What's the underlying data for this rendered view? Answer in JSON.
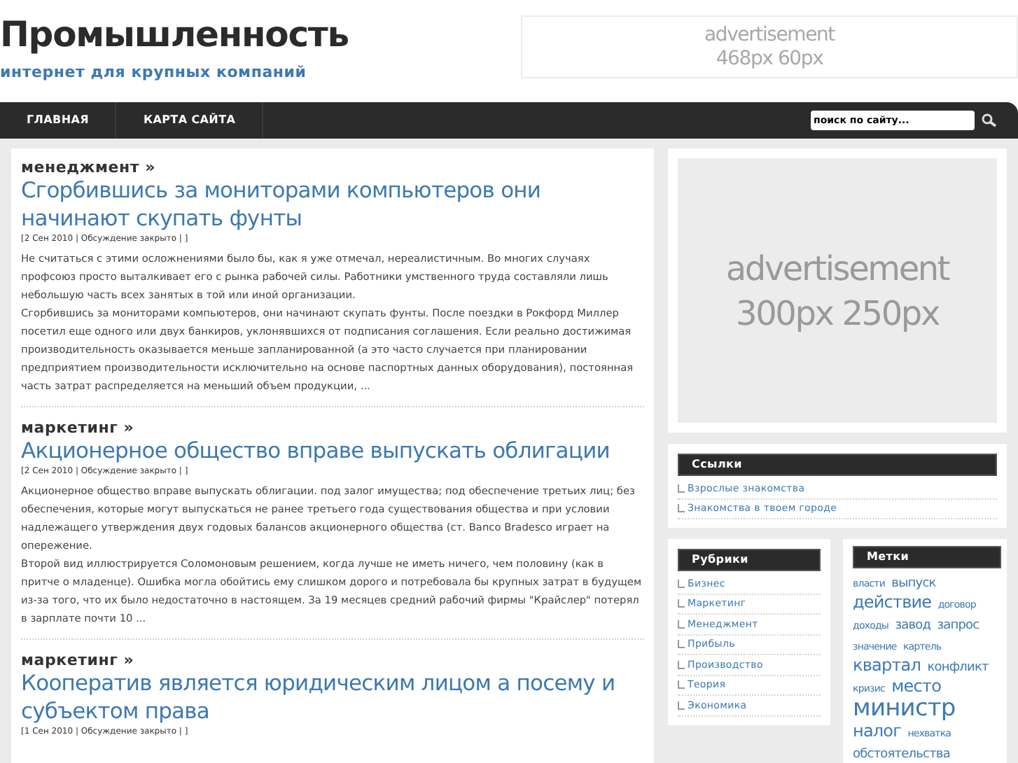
{
  "site": {
    "title": "Промышленность",
    "tagline": "интернет для крупных компаний"
  },
  "header_ad": {
    "lines": [
      "advertisement",
      "468px 60px"
    ]
  },
  "nav": {
    "items": [
      {
        "label": "ГЛАВНАЯ"
      },
      {
        "label": "КАРТА САЙТА"
      }
    ],
    "search": {
      "placeholder": "поиск по сайту..."
    }
  },
  "posts": [
    {
      "category": "менеджмент »",
      "title": "Сгорбившись за мониторами компьютеров они начинают скупать фунты",
      "meta": "[2 Сен 2010 | Обсуждение закрыто | ]",
      "paragraphs": [
        "Не считаться с этими осложнениями было бы, как я уже отмечал, нереалистичным. Во многих случаях профсоюз просто выталкивает его с рынка рабочей силы. Работники умственного труда составляли лишь небольшую часть всех занятых в той или иной организации.",
        "Сгорбившись за мониторами компьютеров, они начинают скупать фунты. После поездки в Рокфорд Миллер посетил еще одного или двух банкиров, уклонявшихся от подписания соглашения. Если реально достижимая производительность оказывается меньше запланированной (а это часто случается при планировании предприятием производительности исключительно на основе паспортных данных оборудования), постоянная часть затрат распределяется на меньший объем продукции, ..."
      ]
    },
    {
      "category": "маркетинг »",
      "title": "Акционерное общество вправе выпускать облигации",
      "meta": "[2 Сен 2010 | Обсуждение закрыто | ]",
      "paragraphs": [
        "Акционерное общество вправе выпускать облигации. под залог имущества; под обеспечение третьих лиц; без обеспечения, которые могут выпускаться не ранее третьего года существования общества и при условии надлежащего утверждения двух годовых балансов акционерного общества (ст. Banco Bradesco играет на опережение.",
        "Второй вид иллюстрируется Соломоновым решением, когда лучше не иметь ничего, чем половину (как в притче о младенце). Ошибка могла обойтись ему слишком дорого и потребовала бы крупных затрат в будущем из-за того, что их было недостаточно в настоящем. За 19 месяцев средний рабочий фирмы \"Крайслер\" потерял в зарплате почти 10 ..."
      ]
    },
    {
      "category": "маркетинг »",
      "title": "Кооператив является юридическим лицом а посему и субъектом права",
      "meta": "[1 Сен 2010 | Обсуждение закрыто | ]"
    }
  ],
  "sidebar_ad": {
    "lines": [
      "advertisement",
      "300px 250px"
    ]
  },
  "links_widget": {
    "title": "Ссылки",
    "items": [
      "Взрослые знакомства",
      "Знакомства в твоем городе"
    ]
  },
  "rubrics_widget": {
    "title": "Рубрики",
    "items": [
      "Бизнес",
      "Маркетинг",
      "Менеджмент",
      "Прибыль",
      "Производство",
      "Теория",
      "Экономика"
    ]
  },
  "tags_widget": {
    "title": "Метки",
    "tags": [
      {
        "label": "власти",
        "kind": "small"
      },
      {
        "label": "выпуск",
        "kind": "medium"
      },
      {
        "label": "действие",
        "kind": "large"
      },
      {
        "label": "договор",
        "kind": "small"
      },
      {
        "label": "доходы",
        "kind": "small"
      },
      {
        "label": "завод",
        "kind": "medium"
      },
      {
        "label": "запрос",
        "kind": "medium"
      },
      {
        "label": "значение",
        "kind": "small"
      },
      {
        "label": "картель",
        "kind": "small"
      },
      {
        "label": "квартал",
        "kind": "large"
      },
      {
        "label": "конфликт",
        "kind": "medium"
      },
      {
        "label": "кризис",
        "kind": "small"
      },
      {
        "label": "место",
        "kind": "large"
      },
      {
        "label": "министр",
        "kind": "xlarge"
      },
      {
        "label": "налог",
        "kind": "large"
      },
      {
        "label": "нехватка",
        "kind": "small"
      },
      {
        "label": "обстоятельства",
        "kind": "medium"
      }
    ]
  }
}
